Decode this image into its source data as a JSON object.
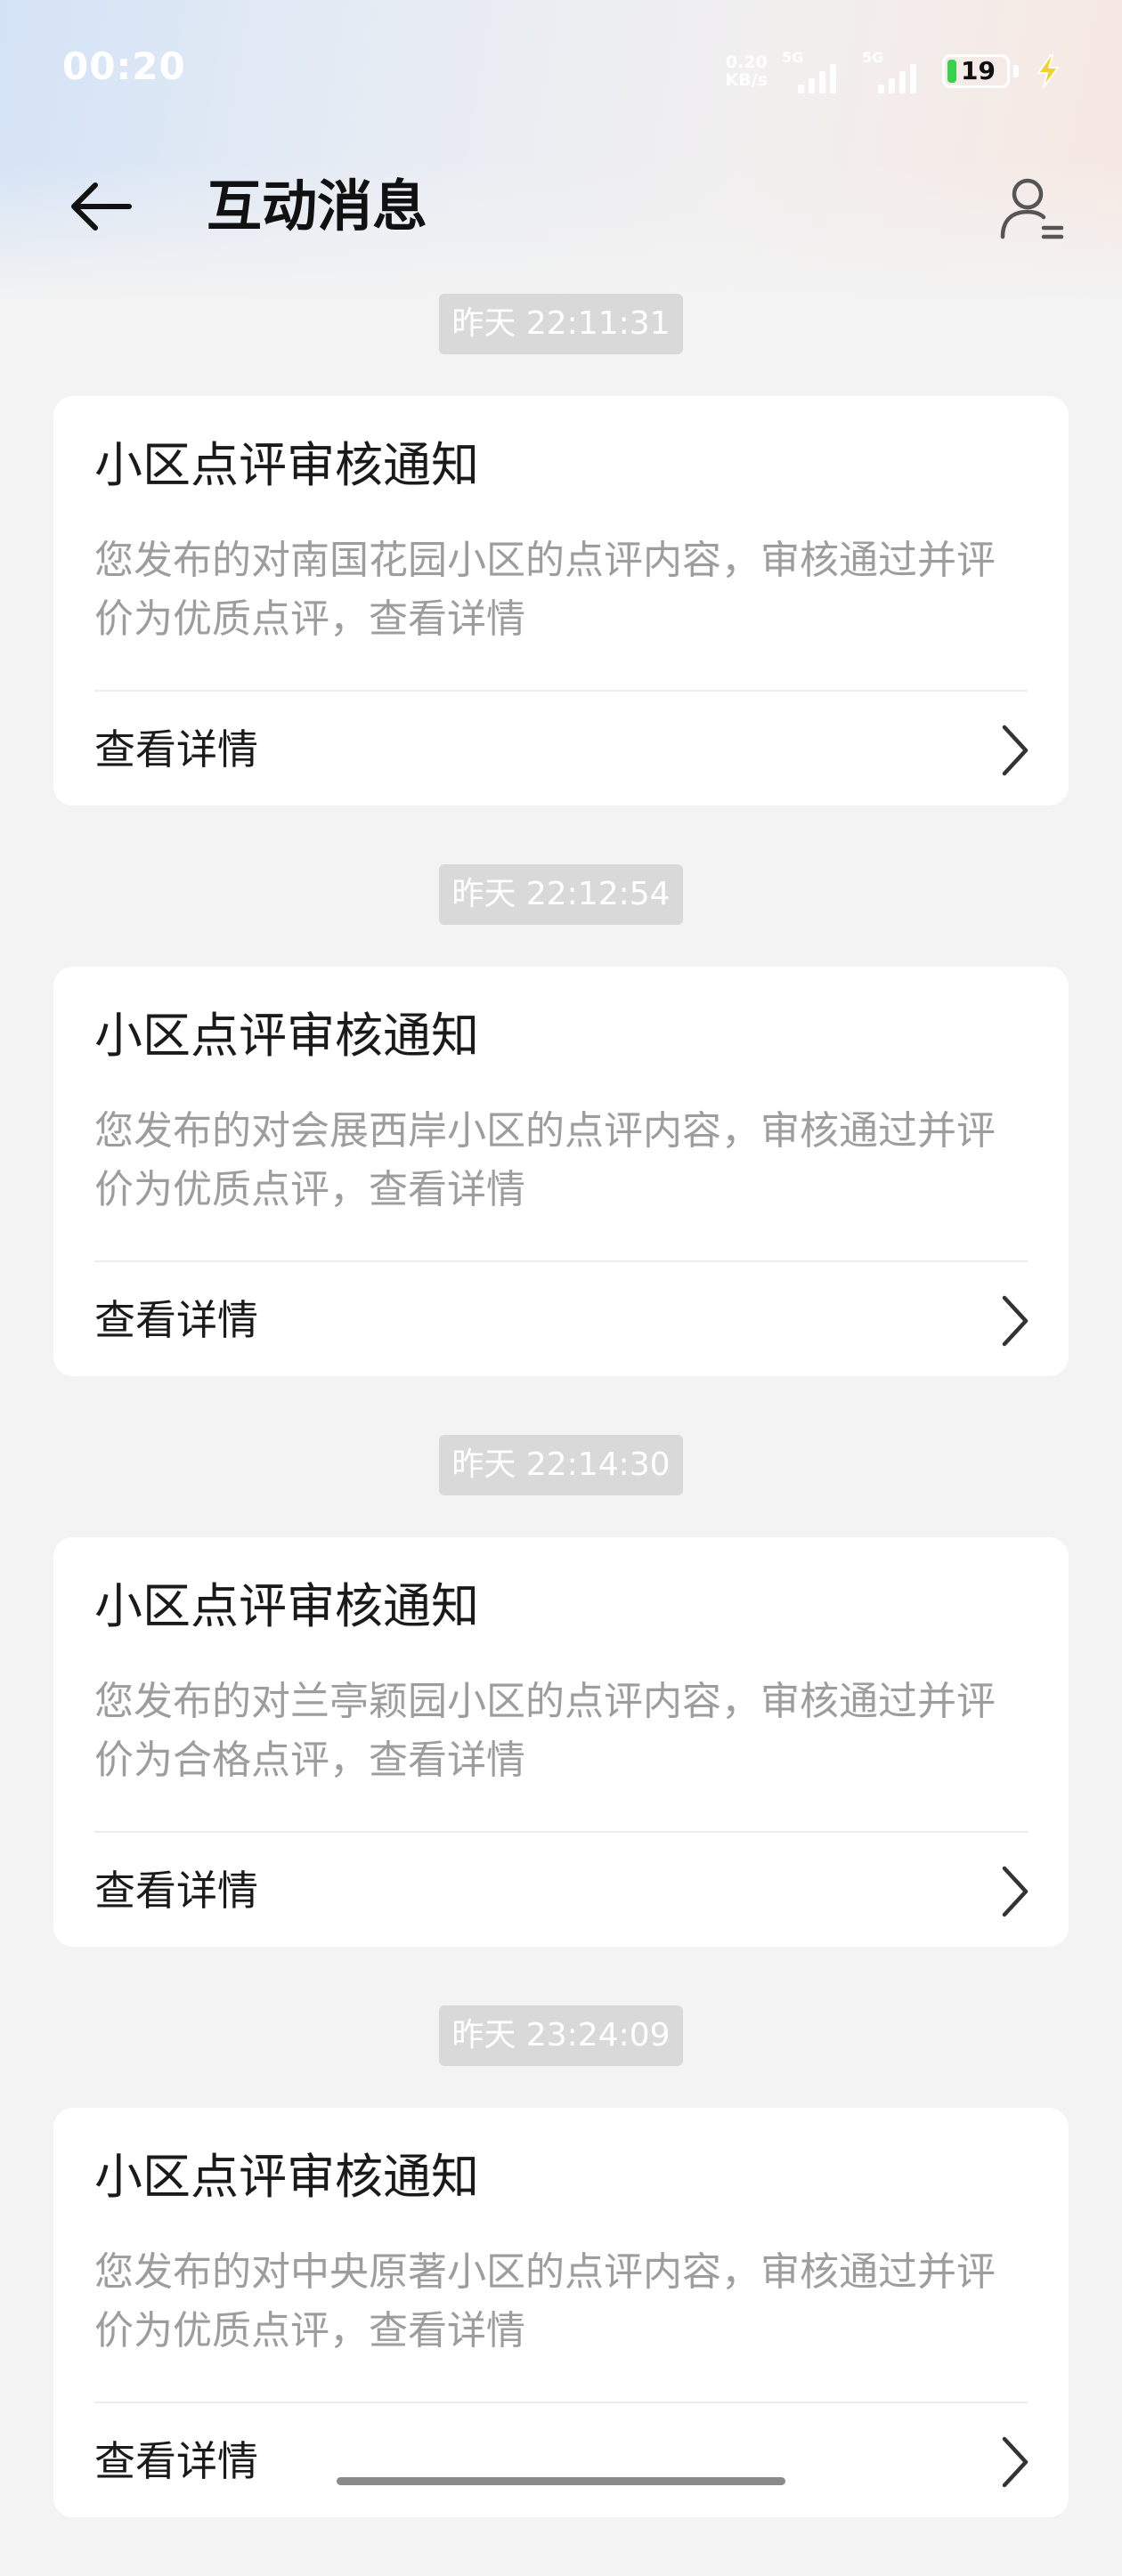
{
  "status_bar": {
    "time": "00:20",
    "net_speed_value": "0.20",
    "net_speed_unit": "KB/s",
    "signal_1_label": "5G",
    "signal_2_label": "5G",
    "battery_level": "19"
  },
  "header": {
    "title": "互动消息"
  },
  "messages": [
    {
      "time": "昨天 22:11:31",
      "title": "小区点评审核通知",
      "body": "您发布的对南国花园小区的点评内容，审核通过并评价为优质点评，查看详情",
      "link_label": "查看详情"
    },
    {
      "time": "昨天 22:12:54",
      "title": "小区点评审核通知",
      "body": "您发布的对会展西岸小区的点评内容，审核通过并评价为优质点评，查看详情",
      "link_label": "查看详情"
    },
    {
      "time": "昨天 22:14:30",
      "title": "小区点评审核通知",
      "body": "您发布的对兰亭颖园小区的点评内容，审核通过并评价为合格点评，查看详情",
      "link_label": "查看详情"
    },
    {
      "time": "昨天 23:24:09",
      "title": "小区点评审核通知",
      "body": "您发布的对中央原著小区的点评内容，审核通过并评价为优质点评，查看详情",
      "link_label": "查看详情"
    }
  ],
  "icons": {
    "back": "arrow-left-icon",
    "profile": "user-settings-icon",
    "chevron": "chevron-right-icon",
    "signal": "signal-bars-icon",
    "battery": "battery-icon",
    "charging": "lightning-icon"
  },
  "colors": {
    "background": "#f3f3f3",
    "card": "#ffffff",
    "timestamp_bg": "#d9d9d9",
    "body_text": "#9d9d9d",
    "battery_fill": "#35d24a",
    "charging": "#f6d02a"
  }
}
